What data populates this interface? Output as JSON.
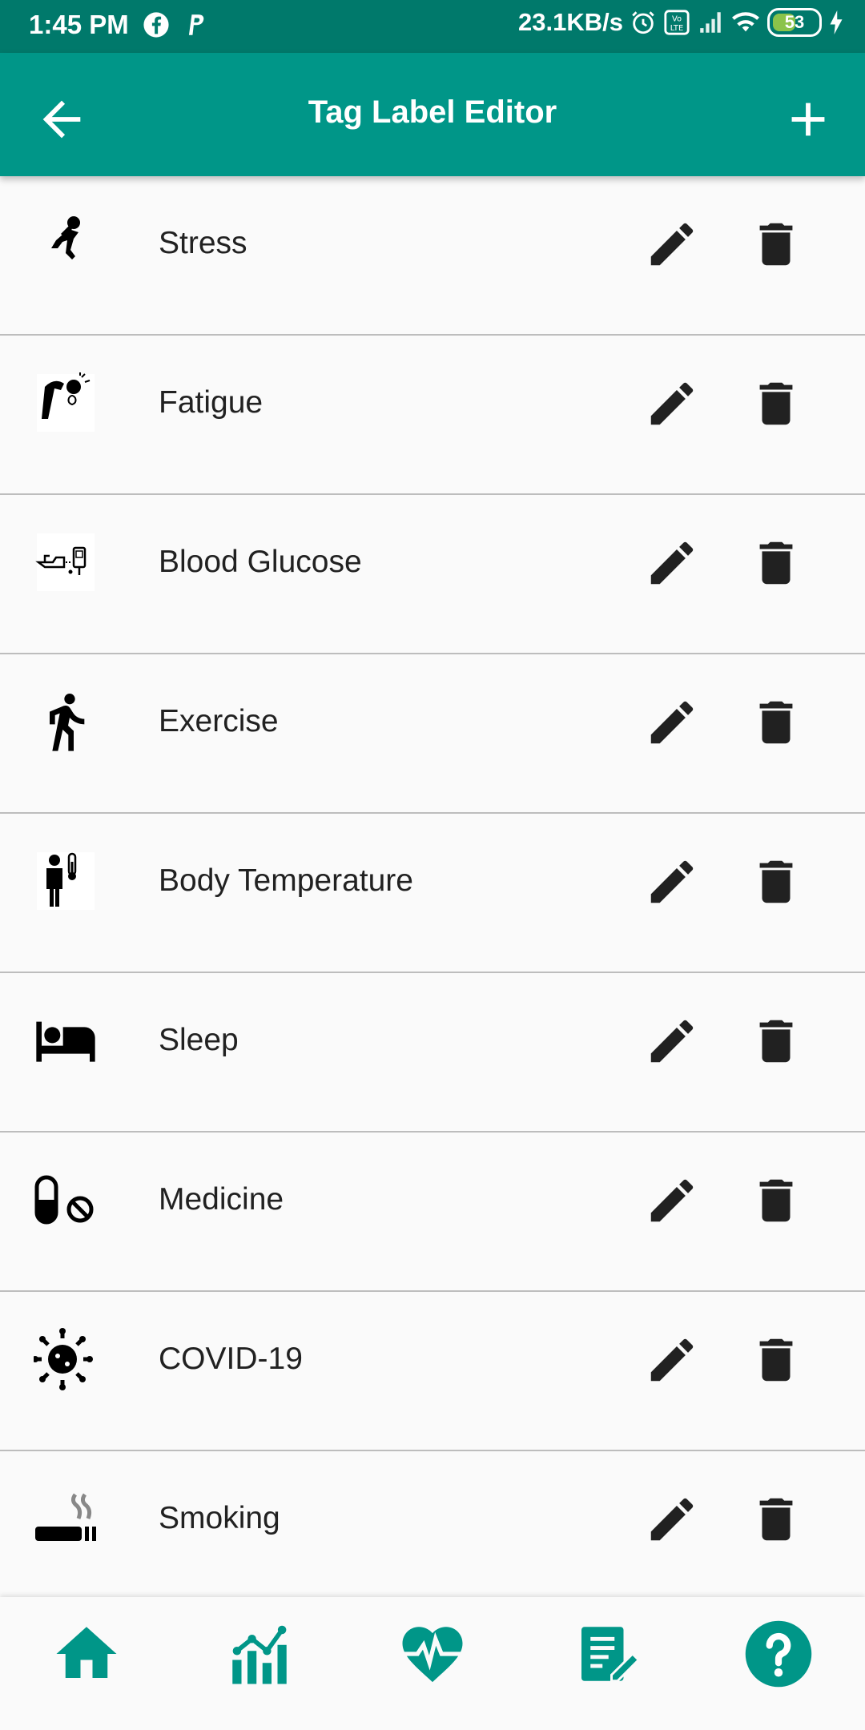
{
  "status_bar": {
    "time": "1:45 PM",
    "speed": "23.1KB/s",
    "battery": "53"
  },
  "app_bar": {
    "title": "Tag Label Editor"
  },
  "tags": [
    {
      "label": "Stress",
      "icon": "stress-icon"
    },
    {
      "label": "Fatigue",
      "icon": "fatigue-icon"
    },
    {
      "label": "Blood Glucose",
      "icon": "blood-glucose-icon"
    },
    {
      "label": "Exercise",
      "icon": "exercise-icon"
    },
    {
      "label": "Body Temperature",
      "icon": "body-temperature-icon"
    },
    {
      "label": "Sleep",
      "icon": "sleep-icon"
    },
    {
      "label": "Medicine",
      "icon": "medicine-icon"
    },
    {
      "label": "COVID-19",
      "icon": "covid-icon"
    },
    {
      "label": "Smoking",
      "icon": "smoking-icon"
    }
  ],
  "bottom_nav": [
    "home-icon",
    "chart-icon",
    "heart-rate-icon",
    "notes-icon",
    "help-icon"
  ],
  "colors": {
    "status_bar": "#00796b",
    "app_bar": "#009688",
    "nav_icon": "#009688"
  }
}
